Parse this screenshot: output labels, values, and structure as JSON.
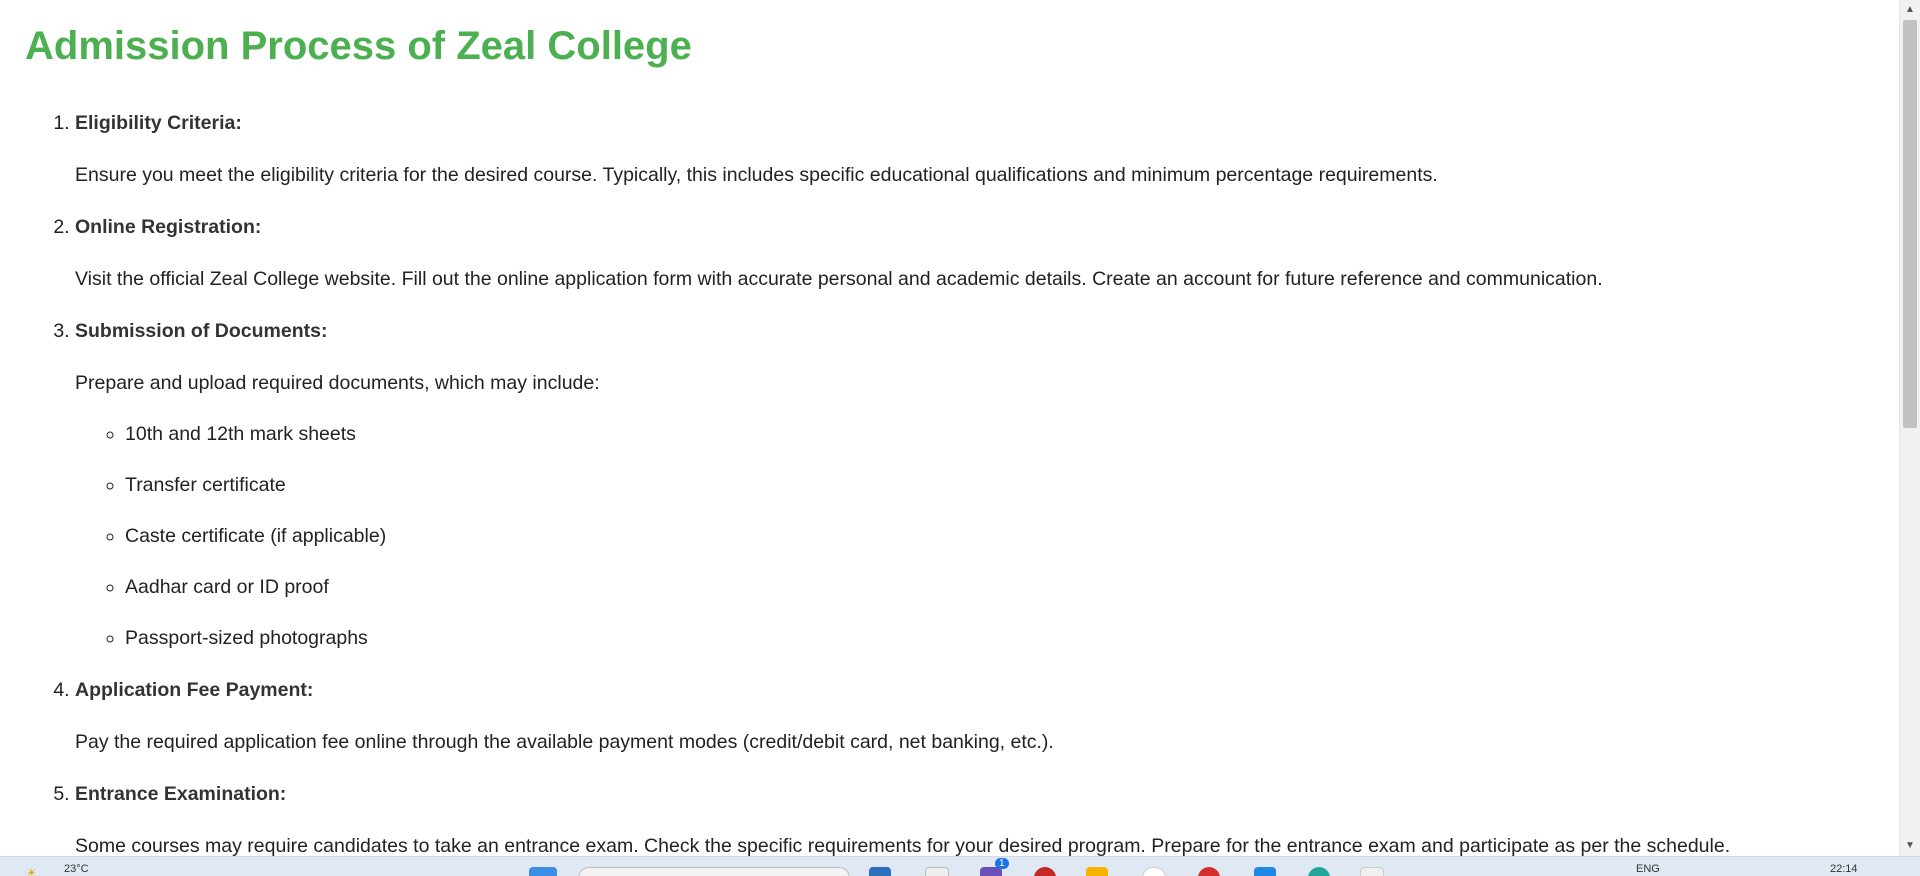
{
  "page": {
    "title": "Admission Process of Zeal College",
    "steps": [
      {
        "title": "Eligibility Criteria:",
        "description": "Ensure you meet the eligibility criteria for the desired course. Typically, this includes specific educational qualifications and minimum percentage requirements."
      },
      {
        "title": "Online Registration:",
        "description": "Visit the official Zeal College website. Fill out the online application form with accurate personal and academic details. Create an account for future reference and communication."
      },
      {
        "title": "Submission of Documents:",
        "description": "Prepare and upload required documents, which may include:",
        "documents": [
          "10th and 12th mark sheets",
          "Transfer certificate",
          "Caste certificate (if applicable)",
          "Aadhar card or ID proof",
          "Passport-sized photographs"
        ]
      },
      {
        "title": "Application Fee Payment:",
        "description": "Pay the required application fee online through the available payment modes (credit/debit card, net banking, etc.)."
      },
      {
        "title": "Entrance Examination:",
        "description": "Some courses may require candidates to take an entrance exam. Check the specific requirements for your desired program. Prepare for the entrance exam and participate as per the schedule."
      }
    ]
  },
  "taskbar": {
    "weather": "23°C",
    "language": "ENG",
    "time": "22:14",
    "notification_count": "1"
  },
  "colors": {
    "heading": "#4caf50",
    "text": "#222222"
  }
}
